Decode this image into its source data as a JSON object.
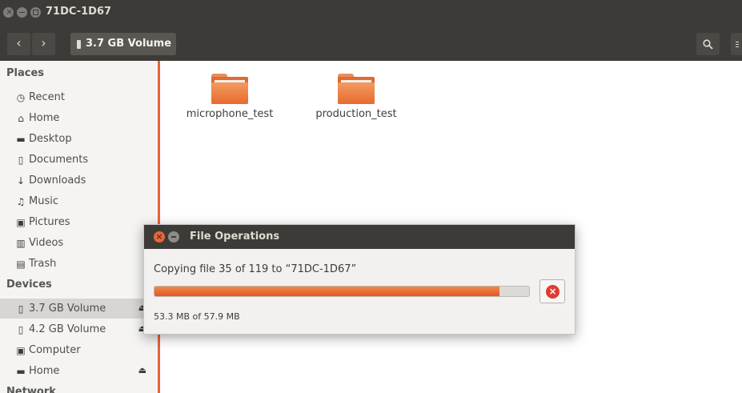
{
  "window": {
    "title": "71DC-1D67"
  },
  "toolbar": {
    "back_icon": "chevron-left-icon",
    "forward_icon": "chevron-right-icon",
    "path_label": "3.7 GB Volume",
    "search_icon": "search-icon"
  },
  "sidebar": {
    "places_header": "Places",
    "places": [
      {
        "label": "Recent",
        "icon": "clock-icon"
      },
      {
        "label": "Home",
        "icon": "home-icon"
      },
      {
        "label": "Desktop",
        "icon": "folder-icon"
      },
      {
        "label": "Documents",
        "icon": "document-icon"
      },
      {
        "label": "Downloads",
        "icon": "download-icon"
      },
      {
        "label": "Music",
        "icon": "music-icon"
      },
      {
        "label": "Pictures",
        "icon": "camera-icon"
      },
      {
        "label": "Videos",
        "icon": "film-icon"
      },
      {
        "label": "Trash",
        "icon": "trash-icon"
      }
    ],
    "devices_header": "Devices",
    "devices": [
      {
        "label": "3.7 GB Volume",
        "icon": "usb-drive-icon",
        "selected": true
      },
      {
        "label": "4.2 GB Volume",
        "icon": "usb-drive-icon"
      },
      {
        "label": "Computer",
        "icon": "computer-icon"
      },
      {
        "label": "Home",
        "icon": "drive-icon"
      }
    ],
    "network_header": "Network"
  },
  "files": [
    {
      "name": "microphone_test",
      "type": "folder"
    },
    {
      "name": "production_test",
      "type": "folder"
    }
  ],
  "dialog": {
    "title": "File Operations",
    "status": "Copying file 35 of 119 to “71DC-1D67”",
    "detail": "53.3 MB of 57.9 MB",
    "progress_percent": 92,
    "cancel_icon": "cancel-icon"
  },
  "colors": {
    "accent": "#e05a22",
    "titlebar": "#3c3b37",
    "sidebar_bg": "#f5f4f2",
    "selection": "#d8d6d2"
  }
}
